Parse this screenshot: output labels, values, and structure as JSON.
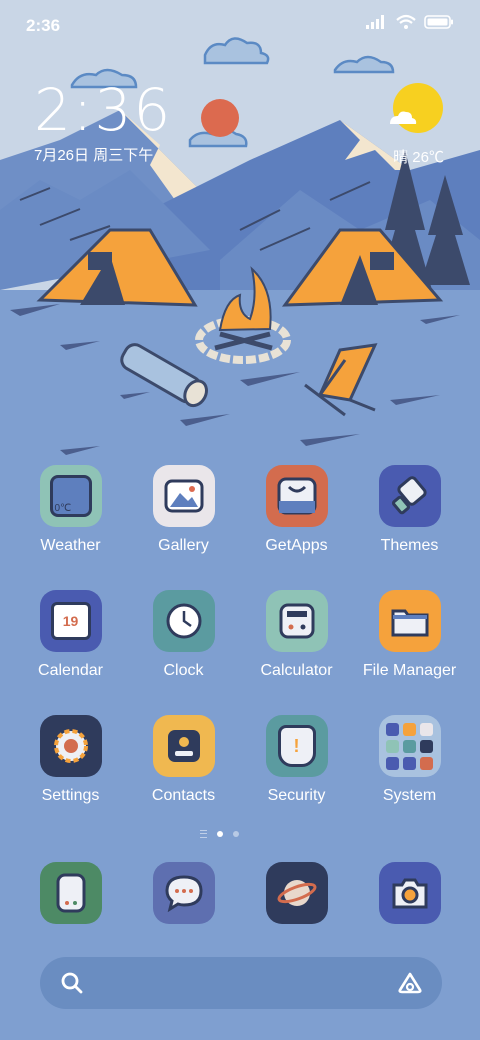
{
  "status": {
    "time": "2:36"
  },
  "clock_widget": {
    "time": "2:36",
    "date": "7月26日 周三下午"
  },
  "weather_widget": {
    "summary": "晴 26℃"
  },
  "apps": [
    {
      "label": "Weather",
      "icon": "weather-icon",
      "badge": "0℃"
    },
    {
      "label": "Gallery",
      "icon": "gallery-icon"
    },
    {
      "label": "GetApps",
      "icon": "getapps-icon"
    },
    {
      "label": "Themes",
      "icon": "themes-icon"
    },
    {
      "label": "Calendar",
      "icon": "calendar-icon",
      "badge": "19"
    },
    {
      "label": "Clock",
      "icon": "clock-icon"
    },
    {
      "label": "Calculator",
      "icon": "calculator-icon"
    },
    {
      "label": "File Manager",
      "icon": "file-manager-icon"
    },
    {
      "label": "Settings",
      "icon": "settings-icon"
    },
    {
      "label": "Contacts",
      "icon": "contacts-icon"
    },
    {
      "label": "Security",
      "icon": "security-icon",
      "badge": "!"
    },
    {
      "label": "System",
      "icon": "system-folder-icon"
    }
  ],
  "dock": [
    {
      "icon": "phone-icon"
    },
    {
      "icon": "messages-icon"
    },
    {
      "icon": "browser-icon"
    },
    {
      "icon": "camera-icon"
    }
  ],
  "page_indicator": {
    "pages": 2,
    "active": 1
  },
  "search": {
    "icon": "search-icon",
    "assistant_icon": "assistant-icon"
  },
  "colors": {
    "sky": "#c9d6e6",
    "ground": "#7f9fd0",
    "tent": "#f5a23c",
    "sun": "#f7d020"
  }
}
